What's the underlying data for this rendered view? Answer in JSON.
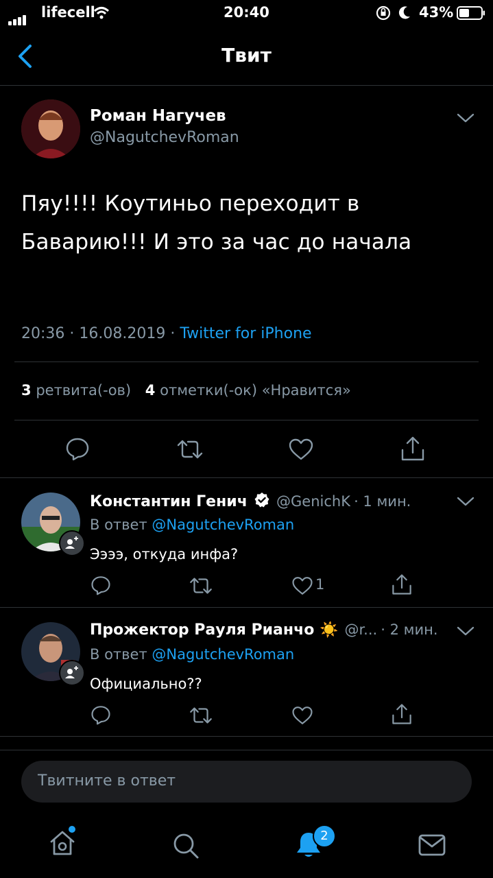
{
  "status_bar": {
    "carrier": "lifecell",
    "time": "20:40",
    "battery": "43%"
  },
  "nav": {
    "title": "Твит"
  },
  "tweet": {
    "name": "Роман Нагучев",
    "handle": "@NagutchevRoman",
    "text_line1": "Пяу!!!! Коутиньо переходит в",
    "text_line2": "Баварию!!! И это за час до начала",
    "timestamp": "20:36 · 16.08.2019 · ",
    "source": "Twitter for iPhone",
    "retweet_count": "3",
    "retweet_label": "ретвита(-ов)",
    "like_count": "4",
    "like_label": "отметки(-ок) «Нравится»"
  },
  "replies": [
    {
      "name": "Константин Генич",
      "handle": "@GenichK",
      "time": "· 1 мин.",
      "reply_prefix": "В ответ",
      "reply_to": "@NagutchevRoman",
      "text": "Ээээ, откуда инфа?",
      "like_count": "1"
    },
    {
      "name": "Прожектор Рауля Рианчо ☀️",
      "handle": "@r...",
      "time": "· 2 мин.",
      "reply_prefix": "В ответ",
      "reply_to": "@NagutchevRoman",
      "text": "Официально??",
      "like_count": ""
    }
  ],
  "compose": {
    "placeholder": "Твитните в ответ"
  },
  "tabbar": {
    "notifications_badge": "2"
  },
  "colors": {
    "accent": "#1da1f2",
    "muted": "#8899a6",
    "background": "#000000"
  }
}
